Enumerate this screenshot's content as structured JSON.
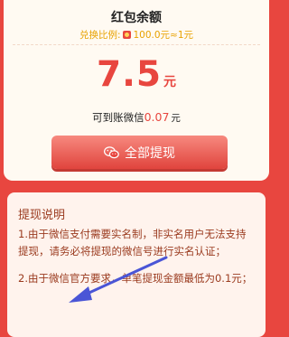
{
  "header": {
    "title": "红包余额",
    "rate_label": "兑换比例:",
    "rate_value": "100.0元≈1元"
  },
  "balance": {
    "amount": "7.5",
    "unit": "元"
  },
  "wechat": {
    "label": "可到账微信",
    "amount": "0.07",
    "unit": "元"
  },
  "withdraw_button": {
    "label": "全部提现",
    "icon": "wechat-icon"
  },
  "notes": {
    "title": "提现说明",
    "items": [
      "1.由于微信支付需要实名制，非实名用户无法支持提现，请务必将提现的微信号进行实名认证；",
      "2.由于微信官方要求，单笔提现金额最低为0.1元；"
    ]
  },
  "colors": {
    "background": "#e8463f",
    "accent": "#e8463f",
    "rate_text": "#e8a200",
    "notes_text": "#9a3a1e"
  }
}
